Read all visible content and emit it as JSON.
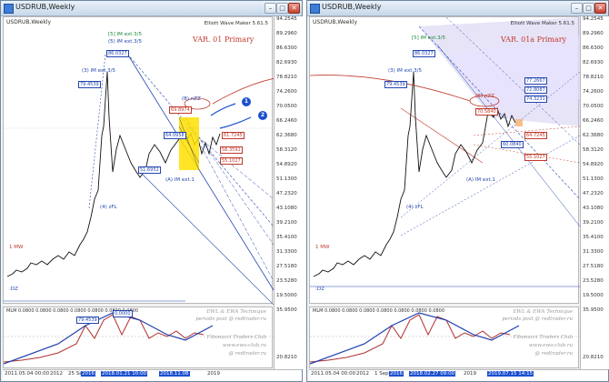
{
  "left": {
    "title": "USDRUB,Weekly",
    "symbol": "USDRUB,Weekly",
    "version": "Elliott Wave Maker 5.61.5",
    "variant": "VAR. 01 Primary",
    "labels": {
      "im_ext": "[5] IM ext.3/5",
      "im_ext2": "(5) IM ext.3/5",
      "im_3": "(3) IM ext.3/5",
      "b_zz": "(B) nZZ",
      "a_im": "(A) IM ext.1",
      "zfl": "(4) zFL",
      "dz": ":DZ",
      "mw": "1 MW"
    },
    "price_boxes": [
      "86.0327",
      "79.4539",
      "69.8974",
      "64.0958",
      "61.7245",
      "51.6952",
      "58.3591",
      "55.1027"
    ],
    "circles": [
      "1",
      "2"
    ],
    "indicator": "MLM 0.0800 0.0800 0.0800 0.0800 0.0800 0.0800 0.0800",
    "ind_boxes": [
      "79.4539",
      "0.0000"
    ],
    "credits": [
      "EWL & EWA Technique",
      "periods post @ redtrader.ru",
      "Fibonacci Traders Club",
      "www.ewa-club.ru",
      "@ redtrader.ru"
    ],
    "ticks": [
      "94.2545",
      "89.2960",
      "86.6300",
      "82.6930",
      "78.8210",
      "74.2600",
      "70.0500",
      "66.2460",
      "62.3680",
      "58.3120",
      "54.8920",
      "51.1300",
      "47.2320",
      "43.1080",
      "39.2100",
      "35.4100",
      "31.3300",
      "27.5180",
      "23.5280",
      "19.5000",
      "35.9500",
      "20.8210"
    ],
    "time_ticks": [
      "2011.05.04 00:00",
      "2012",
      "25 Sep",
      "2016",
      "2018.01.21 10:00",
      "2018.11.08",
      "2019"
    ],
    "colors": {
      "accent": "#2346b0",
      "red": "#c0392b",
      "highlight": "#ffe100"
    }
  },
  "right": {
    "title": "USDRUB,Weekly",
    "symbol": "USDRUB,Weekly",
    "version": "Elliott Wave Maker 5.61.5",
    "variant": "VAR. 01a Primary",
    "labels": {
      "im_ext": "[5] IM ext.3/5",
      "im_3": "(3) IM ext.3/5",
      "a_im": "(A) IM ext.1",
      "zfl": "(4) zFL",
      "dz": ":DZ",
      "mw": "1 MW",
      "zz": "(B) nZZ"
    },
    "price_boxes": [
      "86.0327",
      "79.4539",
      "72.8087",
      "74.3231",
      "77.2667",
      "70.5840",
      "64.7245",
      "60.0840",
      "55.1027"
    ],
    "indicator": "MLM 0.0800 0.0800 0.0800 0.0800 0.0800 0.0800 0.0800",
    "credits": [
      "EWL & EWA Technique",
      "periods post @ redtrader.ru",
      "Fibonacci Traders Club",
      "www.ewa-club.ru",
      "@ redtrader.ru"
    ],
    "ticks": [
      "94.2545",
      "89.2960",
      "86.6300",
      "82.6930",
      "78.8210",
      "74.2600",
      "70.0500",
      "66.2460",
      "62.3680",
      "58.3120",
      "54.8920",
      "51.1300",
      "47.2320",
      "43.1080",
      "39.2100",
      "35.4100",
      "31.3300",
      "27.5180",
      "23.5280",
      "19.5000",
      "35.9500",
      "20.8210"
    ],
    "time_ticks": [
      "2011.05.04 00:00",
      "2012",
      "1 Sep",
      "2016",
      "2018.02.27 09:00",
      "2019",
      "2019.07.15 14:15"
    ],
    "colors": {
      "accent": "#2346b0",
      "red": "#c0392b",
      "band": "#c9c4f0"
    }
  }
}
